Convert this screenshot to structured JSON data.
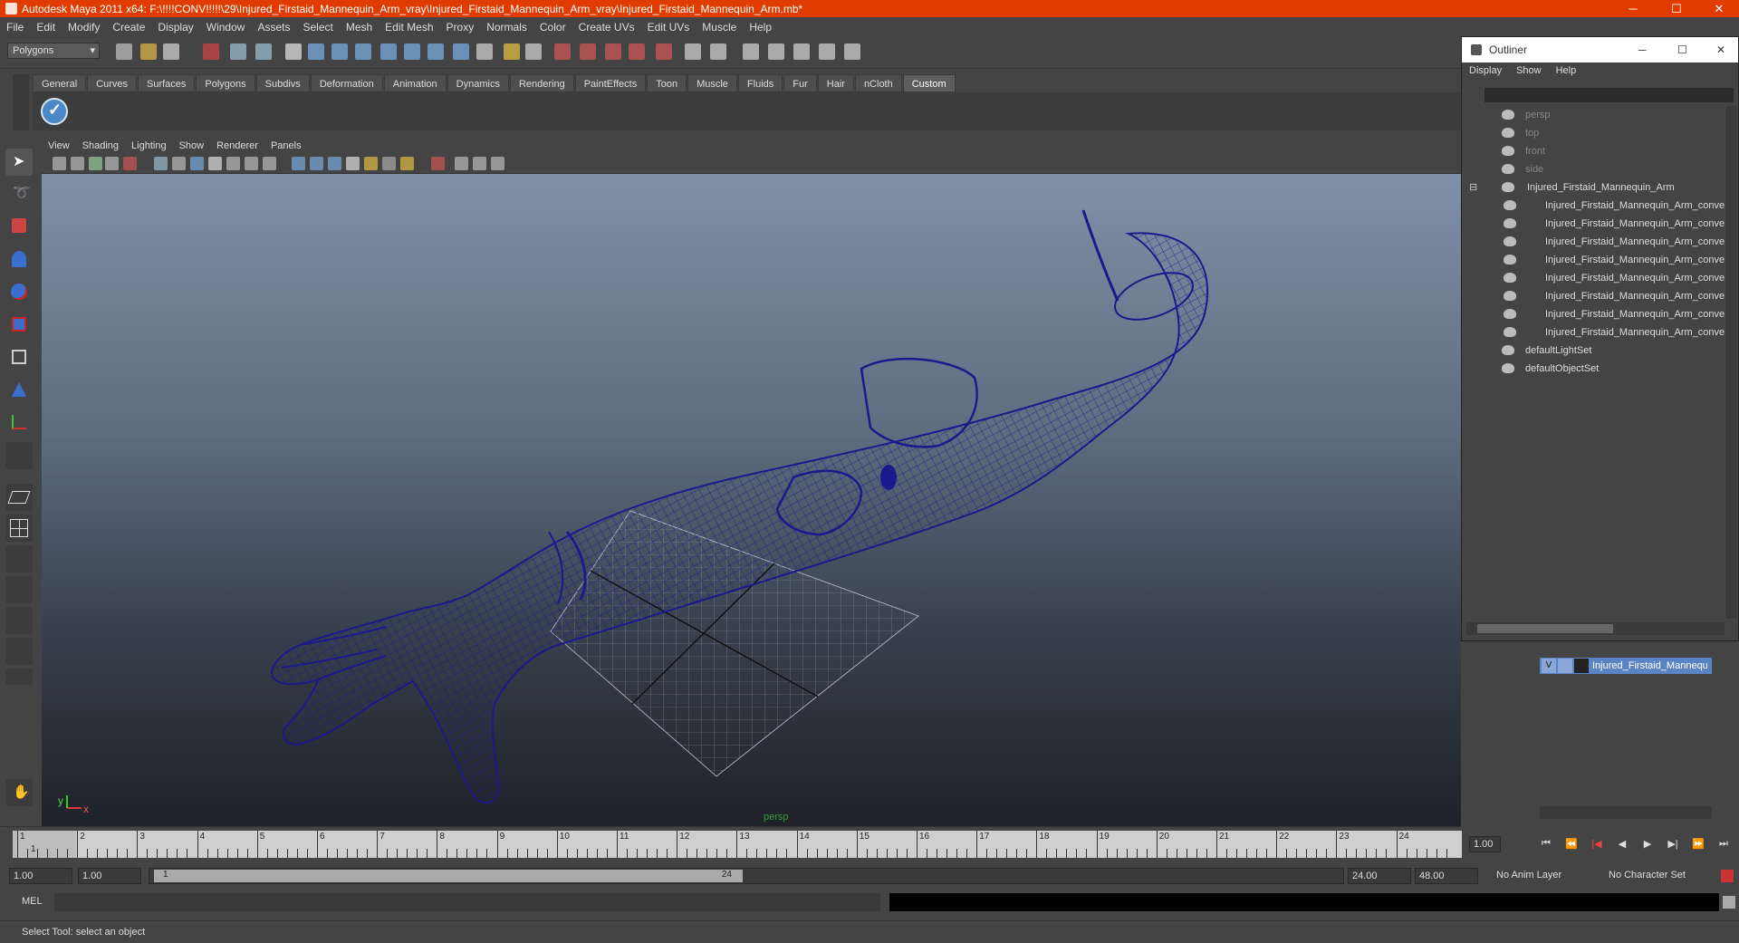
{
  "window": {
    "title": "Autodesk Maya 2011 x64: F:\\!!!!CONV!!!!!\\29\\Injured_Firstaid_Mannequin_Arm_vray\\Injured_Firstaid_Mannequin_Arm_vray\\Injured_Firstaid_Mannequin_Arm.mb*",
    "minimize": "─",
    "maximize": "☐",
    "close": "✕"
  },
  "menubar": [
    "File",
    "Edit",
    "Modify",
    "Create",
    "Display",
    "Window",
    "Assets",
    "Select",
    "Mesh",
    "Edit Mesh",
    "Proxy",
    "Normals",
    "Color",
    "Create UVs",
    "Edit UVs",
    "Muscle",
    "Help"
  ],
  "status": {
    "mode": "Polygons"
  },
  "shelf": {
    "tabs": [
      "General",
      "Curves",
      "Surfaces",
      "Polygons",
      "Subdivs",
      "Deformation",
      "Animation",
      "Dynamics",
      "Rendering",
      "PaintEffects",
      "Toon",
      "Muscle",
      "Fluids",
      "Fur",
      "Hair",
      "nCloth",
      "Custom"
    ],
    "active": "Custom"
  },
  "panel": {
    "menus": [
      "View",
      "Shading",
      "Lighting",
      "Show",
      "Renderer",
      "Panels"
    ],
    "camera_label": "persp"
  },
  "timeline": {
    "ticks": [
      "1",
      "2",
      "3",
      "4",
      "5",
      "6",
      "7",
      "8",
      "9",
      "10",
      "11",
      "12",
      "13",
      "14",
      "15",
      "16",
      "17",
      "18",
      "19",
      "20",
      "21",
      "22",
      "23",
      "24"
    ],
    "current": "1",
    "current_frame_field": "1.00"
  },
  "range": {
    "start": "1.00",
    "playback_start": "1.00",
    "slider_start": "1",
    "slider_end": "24",
    "playback_end": "24.00",
    "end": "48.00",
    "anim_layer": "No Anim Layer",
    "character_set": "No Character Set"
  },
  "cmdline": {
    "lang": "MEL"
  },
  "helpline": {
    "text": "Select Tool: select an object"
  },
  "outliner": {
    "title": "Outliner",
    "menus": [
      "Display",
      "Show",
      "Help"
    ],
    "items": [
      {
        "label": "persp",
        "dim": true
      },
      {
        "label": "top",
        "dim": true
      },
      {
        "label": "front",
        "dim": true
      },
      {
        "label": "side",
        "dim": true
      },
      {
        "label": "Injured_Firstaid_Mannequin_Arm",
        "dim": false
      },
      {
        "label": "Injured_Firstaid_Mannequin_Arm_conve",
        "dim": false
      },
      {
        "label": "Injured_Firstaid_Mannequin_Arm_conve",
        "dim": false
      },
      {
        "label": "Injured_Firstaid_Mannequin_Arm_conve",
        "dim": false
      },
      {
        "label": "Injured_Firstaid_Mannequin_Arm_conve",
        "dim": false
      },
      {
        "label": "Injured_Firstaid_Mannequin_Arm_conve",
        "dim": false
      },
      {
        "label": "Injured_Firstaid_Mannequin_Arm_conve",
        "dim": false
      },
      {
        "label": "Injured_Firstaid_Mannequin_Arm_conve",
        "dim": false
      },
      {
        "label": "Injured_Firstaid_Mannequin_Arm_conve",
        "dim": false
      },
      {
        "label": "defaultLightSet",
        "dim": false
      },
      {
        "label": "defaultObjectSet",
        "dim": false
      }
    ]
  },
  "layers": {
    "visible": "V",
    "name": "Injured_Firstaid_Mannequ"
  },
  "colors": {
    "title_bar": "#e03c00",
    "wire": "#1a1a8c",
    "viewport_top": "#8090a7",
    "viewport_bottom": "#1e2228"
  }
}
